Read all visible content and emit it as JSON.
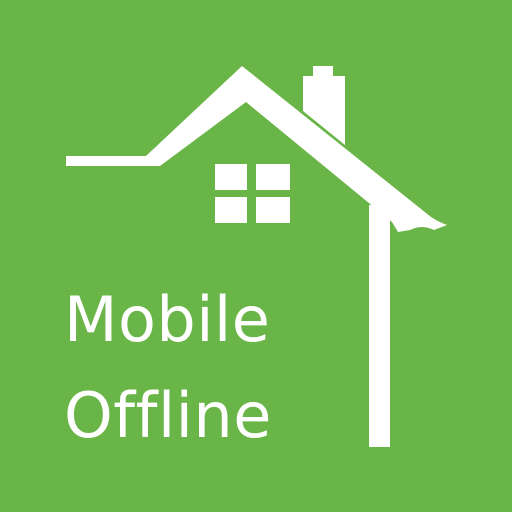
{
  "icon": {
    "background_color": "#6ab547",
    "foreground_color": "#ffffff",
    "graphic": "house-icon",
    "text_lines": [
      "Mobile",
      "Offline"
    ]
  }
}
